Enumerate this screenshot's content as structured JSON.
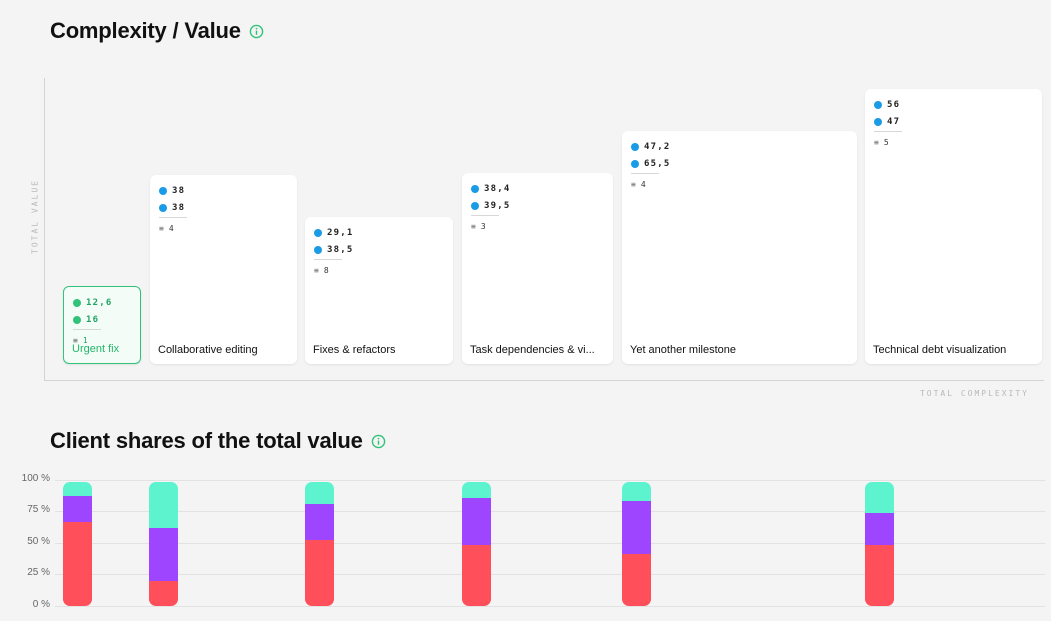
{
  "complexity_section": {
    "title": "Complexity / Value",
    "y_label": "TOTAL VALUE",
    "x_label": "TOTAL COMPLEXITY"
  },
  "client_section": {
    "title": "Client shares of the total value"
  },
  "icons": {
    "info": "info-icon",
    "value": "dollar-circle-icon",
    "complexity": "gauge-icon",
    "items": "list-icon"
  },
  "colors": {
    "accent_green": "#33c27a",
    "value_blue": "#1a9be6",
    "series_red": "#ff4f5a",
    "series_purple": "#9e46ff",
    "series_teal": "#5ef3cf"
  },
  "chart_data": [
    {
      "type": "bar",
      "title": "Complexity / Value",
      "xlabel": "TOTAL COMPLEXITY",
      "ylabel": "TOTAL VALUE",
      "grid": false,
      "categories": [
        "Urgent fix",
        "Collaborative editing",
        "Fixes & refactors",
        "Task dependencies & vi...",
        "Yet another milestone",
        "Technical debt visualization"
      ],
      "value": [
        "12,6",
        "38",
        "29,1",
        "38,4",
        "47,2",
        "56"
      ],
      "complexity": [
        "16",
        "38",
        "38,5",
        "39,5",
        "65,5",
        "47"
      ],
      "items": [
        "1",
        "4",
        "8",
        "3",
        "4",
        "5"
      ],
      "value_numeric": [
        12.6,
        38,
        29.1,
        38.4,
        47.2,
        56
      ],
      "complexity_numeric": [
        16,
        38,
        38.5,
        39.5,
        65.5,
        47
      ],
      "selected": "Urgent fix"
    },
    {
      "type": "bar",
      "stacked": true,
      "title": "Client shares of the total value",
      "ylim": [
        0,
        100
      ],
      "yticks": [
        "100 %",
        "75 %",
        "50 %",
        "25 %",
        "0 %"
      ],
      "grid": true,
      "legend": "none",
      "categories": [
        "Urgent fix",
        "Collaborative editing",
        "Fixes & refactors",
        "Task dependencies & vi...",
        "Yet another milestone",
        "Technical debt visualization"
      ],
      "series": [
        {
          "color": "#ff4f5a",
          "values": [
            68,
            20,
            53,
            49,
            42,
            49
          ]
        },
        {
          "color": "#9e46ff",
          "values": [
            21,
            43,
            29,
            38,
            43,
            26
          ]
        },
        {
          "color": "#5ef3cf",
          "values": [
            11,
            37,
            18,
            13,
            15,
            25
          ]
        }
      ]
    }
  ]
}
